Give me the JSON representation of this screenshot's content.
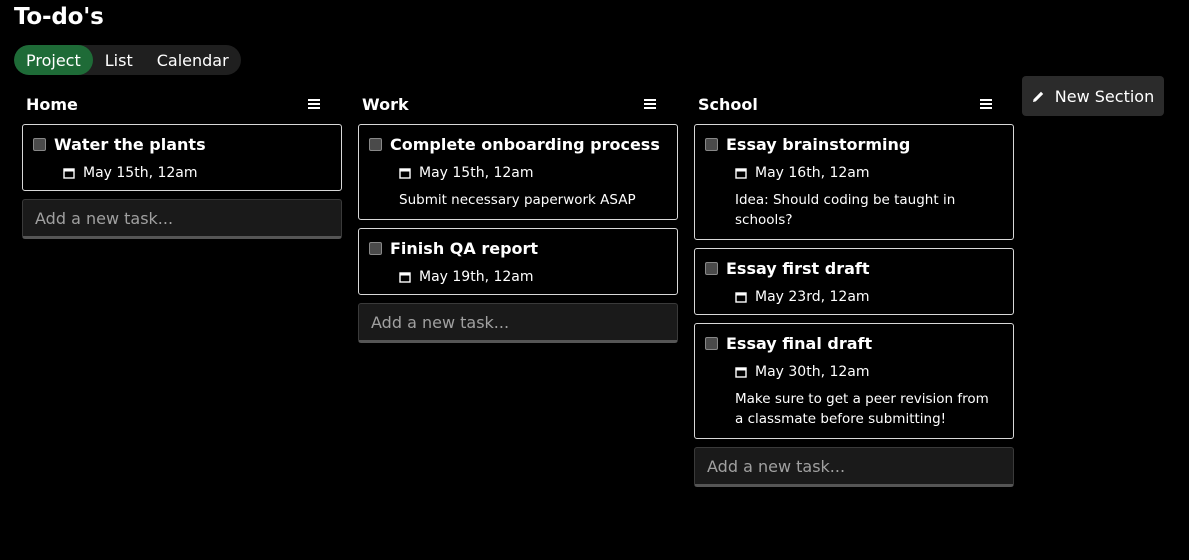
{
  "app": {
    "title": "To-do's"
  },
  "view_tabs": [
    {
      "label": "Project",
      "active": true
    },
    {
      "label": "List",
      "active": false
    },
    {
      "label": "Calendar",
      "active": false
    }
  ],
  "new_section_label": "New Section",
  "add_task_placeholder": "Add a new task...",
  "colors": {
    "active_tab": "#1e6b37",
    "background": "#000000",
    "button": "#2b2b2b"
  },
  "icons": {
    "column_menu": "menu-icon",
    "task_date": "calendar-icon",
    "new_section": "pencil-icon"
  },
  "columns": [
    {
      "title": "Home",
      "tasks": [
        {
          "title": "Water the plants",
          "date": "May 15th, 12am",
          "note": ""
        }
      ]
    },
    {
      "title": "Work",
      "tasks": [
        {
          "title": "Complete onboarding process",
          "date": "May 15th, 12am",
          "note": "Submit necessary paperwork ASAP"
        },
        {
          "title": "Finish QA report",
          "date": "May 19th, 12am",
          "note": ""
        }
      ]
    },
    {
      "title": "School",
      "tasks": [
        {
          "title": "Essay brainstorming",
          "date": "May 16th, 12am",
          "note": "Idea: Should coding be taught in schools?"
        },
        {
          "title": "Essay first draft",
          "date": "May 23rd, 12am",
          "note": ""
        },
        {
          "title": "Essay final draft",
          "date": "May 30th, 12am",
          "note": "Make sure to get a peer revision from a classmate before submitting!"
        }
      ]
    }
  ]
}
